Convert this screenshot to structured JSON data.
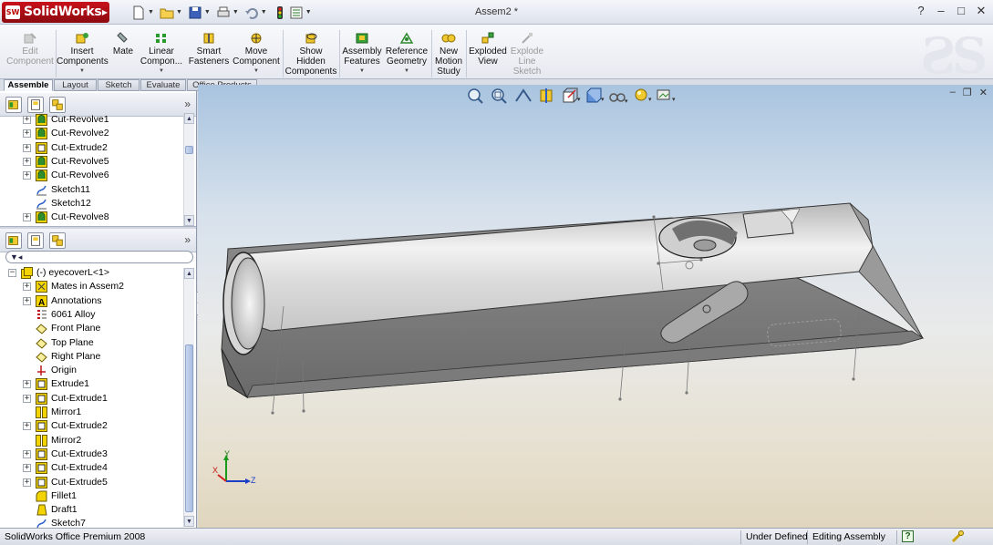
{
  "app": {
    "brand": "SolidWorks",
    "doc_title": "Assem2 *",
    "help_label": "?",
    "window_controls": [
      "–",
      "□",
      "✕"
    ]
  },
  "commands": [
    {
      "label": "Edit\nComponent",
      "enabled": false,
      "icon": "edit-component-icon"
    },
    {
      "label": "Insert\nComponents",
      "enabled": true,
      "icon": "insert-components-icon"
    },
    {
      "label": "Mate",
      "enabled": true,
      "icon": "mate-icon"
    },
    {
      "label": "Linear\nCompon...",
      "enabled": true,
      "icon": "linear-pattern-icon"
    },
    {
      "label": "Smart\nFasteners",
      "enabled": true,
      "icon": "smart-fasteners-icon"
    },
    {
      "label": "Move\nComponent",
      "enabled": true,
      "icon": "move-component-icon"
    },
    {
      "label": "Show\nHidden\nComponents",
      "enabled": true,
      "icon": "show-hidden-icon"
    },
    {
      "label": "Assembly\nFeatures",
      "enabled": true,
      "icon": "assembly-features-icon"
    },
    {
      "label": "Reference\nGeometry",
      "enabled": true,
      "icon": "reference-geometry-icon"
    },
    {
      "label": "New\nMotion\nStudy",
      "enabled": true,
      "icon": "motion-study-icon"
    },
    {
      "label": "Exploded\nView",
      "enabled": true,
      "icon": "exploded-view-icon"
    },
    {
      "label": "Explode\nLine\nSketch",
      "enabled": false,
      "icon": "explode-line-icon"
    }
  ],
  "tabs": [
    "Assemble",
    "Layout",
    "Sketch",
    "Evaluate",
    "Office Products"
  ],
  "active_tab": "Assemble",
  "tree_top": [
    {
      "label": "Cut-Revolve1",
      "icon": "revolve-icon",
      "expandable": true
    },
    {
      "label": "Cut-Revolve2",
      "icon": "revolve-icon",
      "expandable": true
    },
    {
      "label": "Cut-Extrude2",
      "icon": "extrude-icon",
      "expandable": true
    },
    {
      "label": "Cut-Revolve5",
      "icon": "revolve-icon",
      "expandable": true
    },
    {
      "label": "Cut-Revolve6",
      "icon": "revolve-icon",
      "expandable": true
    },
    {
      "label": "Sketch11",
      "icon": "sketch-icon",
      "expandable": false
    },
    {
      "label": "Sketch12",
      "icon": "sketch-icon",
      "expandable": false
    },
    {
      "label": "Cut-Revolve8",
      "icon": "revolve-icon",
      "expandable": true
    }
  ],
  "tree_bottom": {
    "root": "(-) eyecoverL<1>",
    "items": [
      {
        "label": "Mates in Assem2",
        "icon": "mates-icon",
        "expandable": true
      },
      {
        "label": "Annotations",
        "icon": "annotations-icon",
        "expandable": true
      },
      {
        "label": "6061 Alloy",
        "icon": "material-icon",
        "expandable": false
      },
      {
        "label": "Front Plane",
        "icon": "plane-icon",
        "expandable": false
      },
      {
        "label": "Top Plane",
        "icon": "plane-icon",
        "expandable": false
      },
      {
        "label": "Right Plane",
        "icon": "plane-icon",
        "expandable": false
      },
      {
        "label": "Origin",
        "icon": "origin-icon",
        "expandable": false
      },
      {
        "label": "Extrude1",
        "icon": "extrude-icon",
        "expandable": true
      },
      {
        "label": "Cut-Extrude1",
        "icon": "extrude-icon",
        "expandable": true
      },
      {
        "label": "Mirror1",
        "icon": "mirror-icon",
        "expandable": false
      },
      {
        "label": "Cut-Extrude2",
        "icon": "extrude-icon",
        "expandable": true
      },
      {
        "label": "Mirror2",
        "icon": "mirror-icon",
        "expandable": false
      },
      {
        "label": "Cut-Extrude3",
        "icon": "extrude-icon",
        "expandable": true
      },
      {
        "label": "Cut-Extrude4",
        "icon": "extrude-icon",
        "expandable": true
      },
      {
        "label": "Cut-Extrude5",
        "icon": "extrude-icon",
        "expandable": true
      },
      {
        "label": "Fillet1",
        "icon": "fillet-icon",
        "expandable": false
      },
      {
        "label": "Draft1",
        "icon": "draft-icon",
        "expandable": false
      },
      {
        "label": "Sketch7",
        "icon": "sketch-icon",
        "expandable": false
      }
    ]
  },
  "triad": {
    "x": "X",
    "y": "Y",
    "z": "Z"
  },
  "status": {
    "product": "SolidWorks Office Premium 2008",
    "state": "Under Defined",
    "mode": "Editing Assembly",
    "help": "?"
  },
  "colors": {
    "brand_red": "#c9111a",
    "tree_icon_yellow": "#f3d400",
    "model_gray": "#bdbdbd"
  }
}
